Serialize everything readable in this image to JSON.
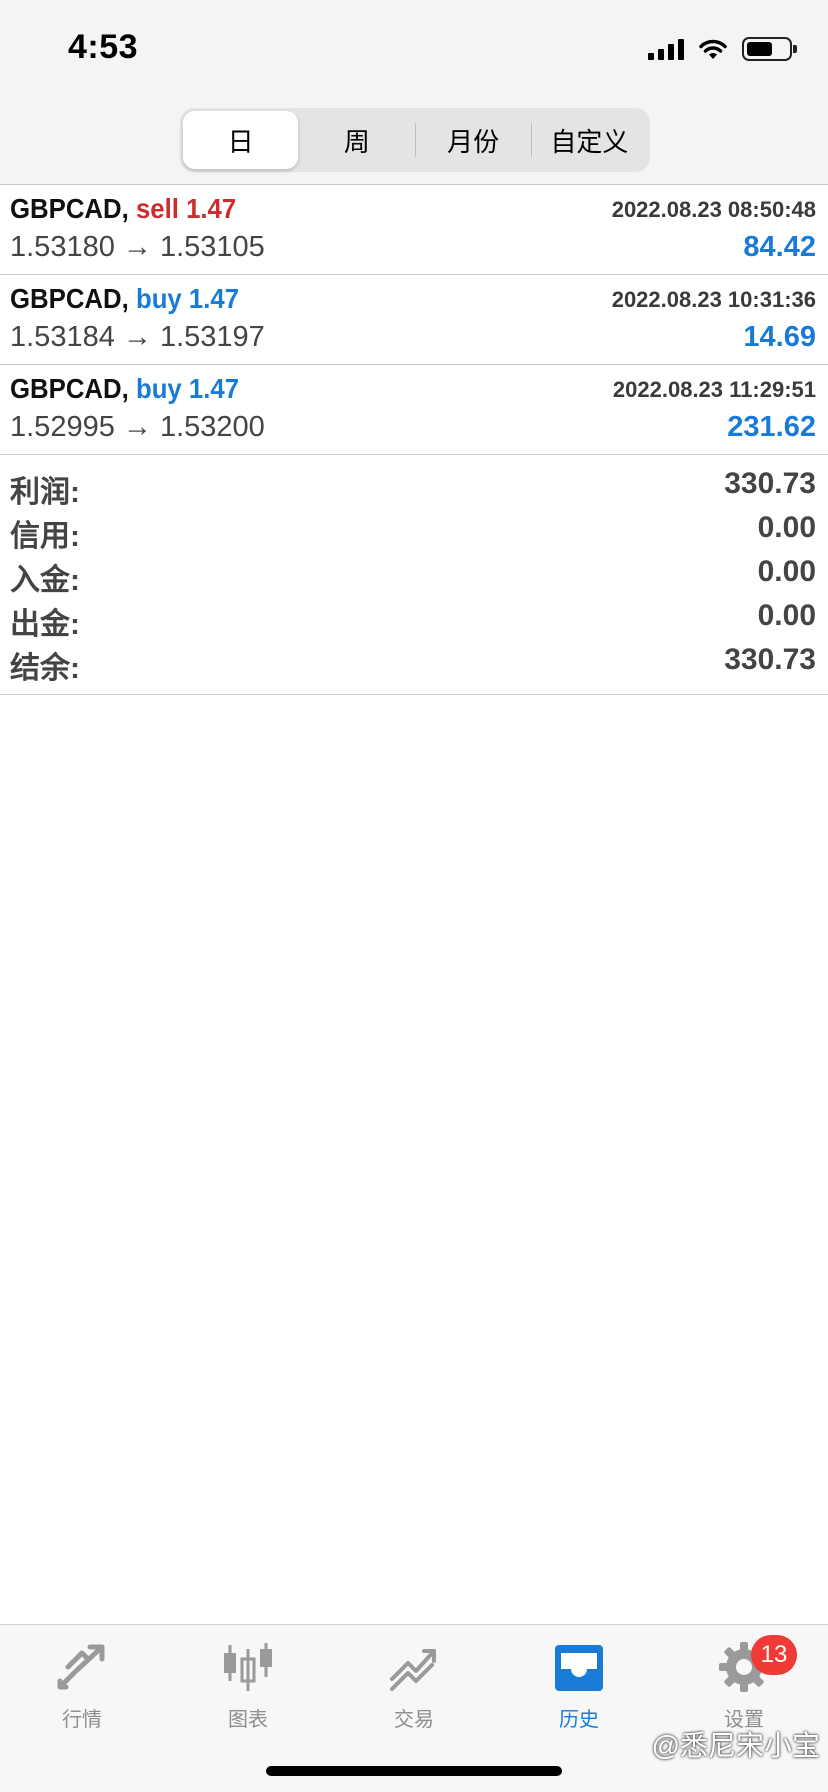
{
  "status_bar": {
    "time": "4:53"
  },
  "segments": [
    {
      "label": "日",
      "active": true
    },
    {
      "label": "周",
      "active": false
    },
    {
      "label": "月份",
      "active": false
    },
    {
      "label": "自定义",
      "active": false
    }
  ],
  "trades": [
    {
      "symbol": "GBPCAD,",
      "side": "sell 1.47",
      "time": "2022.08.23 08:50:48",
      "prices": "1.53180 → 1.53105",
      "profit": "84.42"
    },
    {
      "symbol": "GBPCAD,",
      "side": "buy 1.47",
      "time": "2022.08.23 10:31:36",
      "prices": "1.53184 → 1.53197",
      "profit": "14.69"
    },
    {
      "symbol": "GBPCAD,",
      "side": "buy 1.47",
      "time": "2022.08.23 11:29:51",
      "prices": "1.52995 → 1.53200",
      "profit": "231.62"
    }
  ],
  "summary": [
    {
      "label": "利润:",
      "value": "330.73"
    },
    {
      "label": "信用:",
      "value": "0.00"
    },
    {
      "label": "入金:",
      "value": "0.00"
    },
    {
      "label": "出金:",
      "value": "0.00"
    },
    {
      "label": "结余:",
      "value": "330.73"
    }
  ],
  "tabs": [
    {
      "label": "行情",
      "icon": "arrows-icon"
    },
    {
      "label": "图表",
      "icon": "candlestick-icon"
    },
    {
      "label": "交易",
      "icon": "trade-chart-icon"
    },
    {
      "label": "历史",
      "icon": "inbox-icon",
      "active": true
    },
    {
      "label": "设置",
      "icon": "gear-icon",
      "badge": "13"
    }
  ],
  "watermark": "@悉尼宋小宝",
  "colors": {
    "sell": "#cc2d2d",
    "buy": "#1a7bd6",
    "active_tab": "#1a7bd6",
    "badge": "#f03a35"
  }
}
